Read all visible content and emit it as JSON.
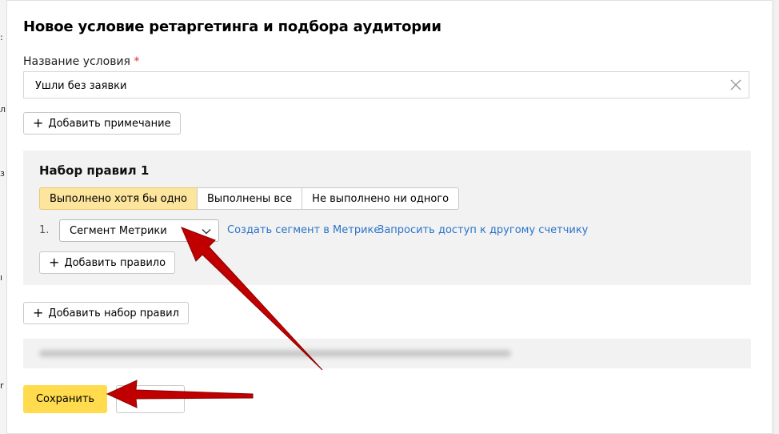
{
  "dialog": {
    "title": "Новое условие ретаргетинга и подбора аудитории",
    "name_label": "Название условия",
    "required_mark": "*",
    "name_value": "Ушли без заявки",
    "add_note_label": "Добавить примечание"
  },
  "rule_set": {
    "title": "Набор правил 1",
    "modes": [
      "Выполнено хотя бы одно",
      "Выполнены все",
      "Не выполнено ни одного"
    ],
    "active_mode_index": 0,
    "rules": [
      {
        "number": "1.",
        "type": "Сегмент Метрики"
      }
    ],
    "create_segment_link": "Создать сегмент в Метрике",
    "request_access_link": "Запросить доступ к другому счетчику",
    "add_rule_label": "Добавить правило"
  },
  "add_rule_set_label": "Добавить набор правил",
  "actions": {
    "save_label": "Сохранить"
  },
  "colors": {
    "accent_yellow": "#ffdb4d",
    "active_segment": "#fde59d",
    "link": "#2a74c9",
    "arrow": "#c00000"
  },
  "icons": {
    "clear": "close-icon",
    "select": "chevron-down-icon",
    "add": "plus-icon"
  }
}
